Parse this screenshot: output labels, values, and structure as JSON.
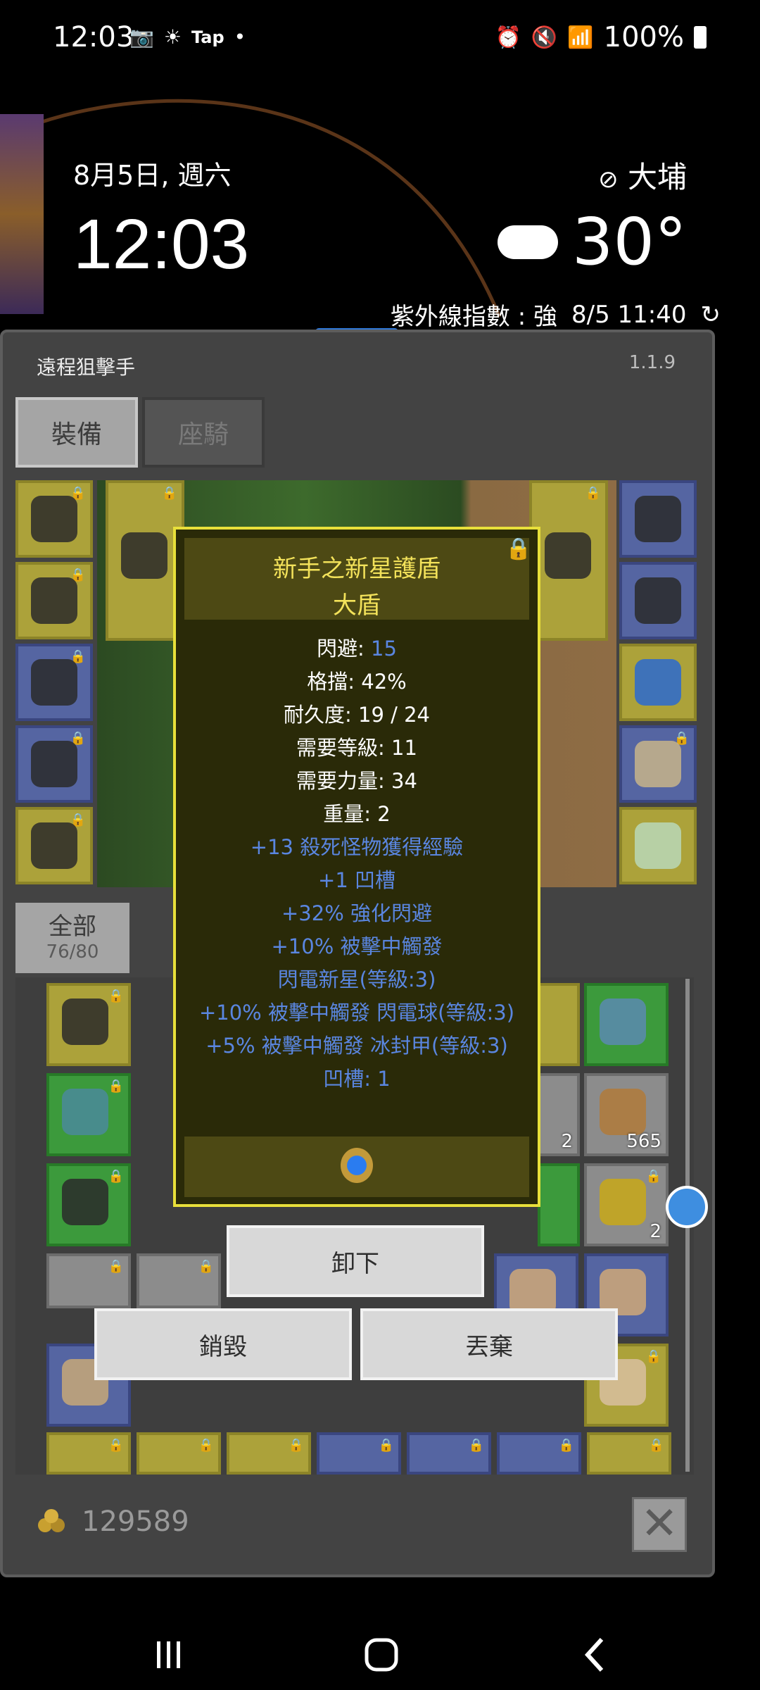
{
  "status_bar": {
    "time": "12:03",
    "app_label": "Tap",
    "battery": "100%"
  },
  "lockscreen": {
    "date": "8月5日, 週六",
    "time": "12:03",
    "location": "大埔",
    "temperature": "30°",
    "uv_text": "紫外線指數 : 強",
    "updated": "8/5 11:40"
  },
  "game": {
    "title": "遠程狙擊手",
    "version": "1.1.9",
    "tabs": [
      {
        "label": "裝備",
        "active": true
      },
      {
        "label": "座騎",
        "active": false
      }
    ],
    "inventory_filter": {
      "label": "全部",
      "count": "76/80"
    },
    "gold": "129589",
    "colors": {
      "yellow_slot": "#aca23a",
      "blue_slot": "#5565a2",
      "green_slot": "#3c9a3c",
      "grey_slot": "#8c8c8c",
      "tooltip_title": "#f3e25a",
      "affix_blue": "#5a86e0"
    },
    "inventory_counts": [
      "2",
      "565",
      "2"
    ]
  },
  "tooltip": {
    "name": "新手之新星護盾",
    "type": "大盾",
    "stats": [
      {
        "label": "閃避: ",
        "value": "15"
      },
      {
        "text": "格擋: 42%"
      },
      {
        "text": "耐久度: 19 / 24"
      },
      {
        "text": "需要等級: 11"
      },
      {
        "text": "需要力量: 34"
      },
      {
        "text": "重量: 2"
      }
    ],
    "affixes": [
      "+13 殺死怪物獲得經驗",
      "+1 凹槽",
      "+32% 強化閃避",
      "+10% 被擊中觸發",
      "閃電新星(等級:3)",
      "+10% 被擊中觸發 閃電球(等級:3)",
      "+5% 被擊中觸發 冰封甲(等級:3)",
      "凹槽: 1"
    ]
  },
  "actions": {
    "unequip": "卸下",
    "destroy": "銷毀",
    "drop": "丟棄"
  }
}
